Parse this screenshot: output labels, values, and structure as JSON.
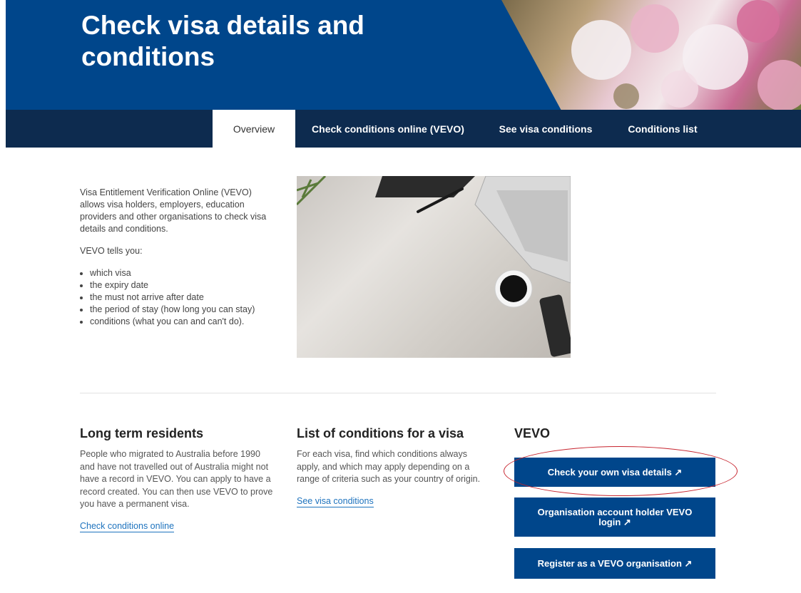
{
  "hero": {
    "title": "Check visa details and conditions"
  },
  "tabs": [
    {
      "label": "Overview",
      "active": true
    },
    {
      "label": "Check conditions online (VEVO)",
      "active": false
    },
    {
      "label": "See visa conditions",
      "active": false
    },
    {
      "label": "Conditions list",
      "active": false
    }
  ],
  "intro": {
    "p1": "Visa Entitlement Verification Online (VEVO) allows visa holders, employers, education providers and other organisations to check visa details and conditions.",
    "p2": "VEVO tells you:",
    "bullets": [
      "which visa",
      "the expiry date",
      "the must not arrive after date",
      "the period of stay (how long you can stay)",
      "conditions (what you can and can't do)."
    ]
  },
  "residents": {
    "heading": "Long term residents",
    "body": "People who migrated to Australia before 1990 and have not travelled out of Australia might not have a record in VEVO. You can  apply to have a record created. You can then use VEVO to prove you have a permanent visa.",
    "link": "Check conditions online"
  },
  "conditions": {
    "heading": "List of conditions for a visa",
    "body": "For each visa, find which conditions always apply, and which may apply depending on a range of criteria such as your country of origin.",
    "link": "See visa conditions"
  },
  "vevo": {
    "heading": "VEVO",
    "buttons": [
      "Check your own visa details ↗",
      "Organisation account holder VEVO login ↗",
      "Register as a VEVO organisation ↗"
    ]
  },
  "colors": {
    "brand_blue": "#00468b",
    "tab_bar": "#0d2b4f",
    "link_blue": "#1e73be",
    "annotation_red": "#c7242e"
  }
}
